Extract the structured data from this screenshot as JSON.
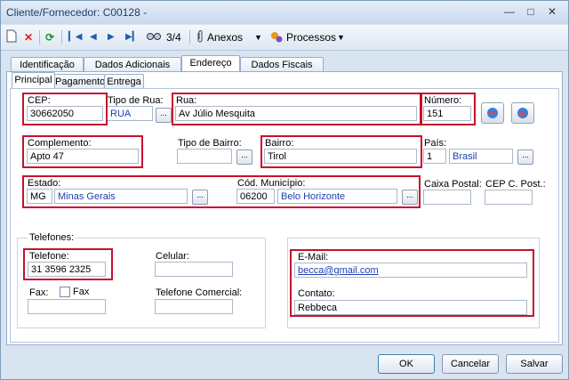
{
  "window": {
    "title": "Cliente/Fornecedor: C00128 -",
    "min_icon": "minimize-icon",
    "max_icon": "maximize-icon",
    "close_icon": "close-icon"
  },
  "toolbar": {
    "record_position": "3/4",
    "attachments_label": "Anexos",
    "processes_label": "Processos"
  },
  "tabs": [
    "Identificação",
    "Dados Adicionais",
    "Endereço",
    "Dados Fiscais"
  ],
  "subtabs": [
    "Principal",
    "Pagamento",
    "Entrega"
  ],
  "address": {
    "cep_label": "CEP:",
    "cep_value": "30662050",
    "street_type_label": "Tipo de Rua:",
    "street_type_value": "RUA",
    "street_label": "Rua:",
    "street_value": "Av Júlio Mesquita",
    "number_label": "Número:",
    "number_value": "151",
    "complement_label": "Complemento:",
    "complement_value": "Apto 47",
    "district_type_label": "Tipo de Bairro:",
    "district_type_value": "",
    "district_label": "Bairro:",
    "district_value": "Tirol",
    "country_label": "País:",
    "country_code": "1",
    "country_name": "Brasil",
    "state_label": "Estado:",
    "state_code": "MG",
    "state_name": "Minas Gerais",
    "city_label": "Cód. Município:",
    "city_code": "06200",
    "city_name": "Belo Horizonte",
    "po_box_label": "Caixa Postal:",
    "po_box_value": "",
    "po_cep_label": "CEP C. Post.:",
    "po_cep_value": ""
  },
  "phones": {
    "group_label": "Telefones:",
    "phone_label": "Telefone:",
    "phone_value": "31 3596 2325",
    "mobile_label": "Celular:",
    "mobile_value": "",
    "fax_label": "Fax:",
    "fax_value": "",
    "fax_check_label": "Fax",
    "work_label": "Telefone Comercial:",
    "work_value": ""
  },
  "contact": {
    "email_label": "E-Mail:",
    "email_value": "becca@gmail.com",
    "contact_label": "Contato:",
    "contact_value": "Rebbeca"
  },
  "buttons": {
    "ok": "OK",
    "cancel": "Cancelar",
    "save": "Salvar"
  },
  "colors": {
    "highlight": "#c8102e",
    "link_blue": "#1c3eb0"
  }
}
